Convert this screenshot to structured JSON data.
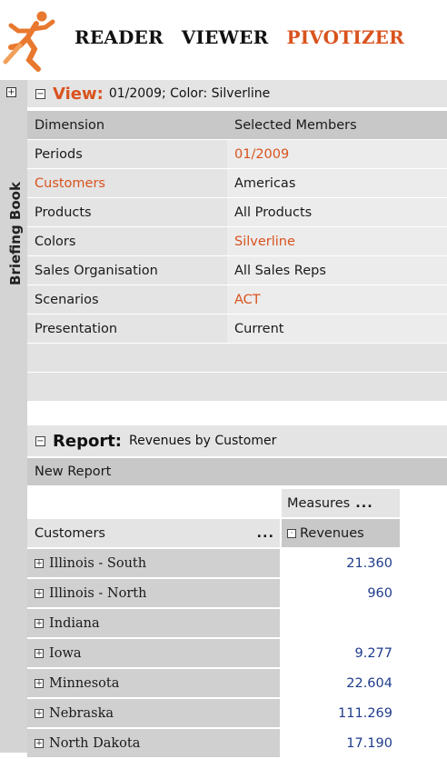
{
  "nav": {
    "reader": "READER",
    "viewer": "VIEWER",
    "pivotizer": "PIVOTIZER"
  },
  "sidebar": {
    "label": "Briefing Book"
  },
  "view": {
    "title": "View:",
    "subtitle": "01/2009; Color: Silverline",
    "headers": {
      "dimension": "Dimension",
      "members": "Selected Members"
    },
    "rows": [
      {
        "dimension": "Periods",
        "member": "01/2009",
        "member_highlight": true,
        "dim_highlight": false
      },
      {
        "dimension": "Customers",
        "member": "Americas",
        "member_highlight": false,
        "dim_highlight": true
      },
      {
        "dimension": "Products",
        "member": "All Products",
        "member_highlight": false,
        "dim_highlight": false
      },
      {
        "dimension": "Colors",
        "member": "Silverline",
        "member_highlight": true,
        "dim_highlight": false
      },
      {
        "dimension": "Sales Organisation",
        "member": "All Sales Reps",
        "member_highlight": false,
        "dim_highlight": false
      },
      {
        "dimension": "Scenarios",
        "member": "ACT",
        "member_highlight": true,
        "dim_highlight": false
      },
      {
        "dimension": "Presentation",
        "member": "Current",
        "member_highlight": false,
        "dim_highlight": false
      }
    ]
  },
  "report": {
    "title": "Report:",
    "subtitle": "Revenues by Customer",
    "new_report": "New Report",
    "measures_label": "Measures",
    "row_dimension": "Customers",
    "measure": "Revenues",
    "more": "...",
    "rows": [
      {
        "customer": "Illinois - South",
        "revenue": "21.360"
      },
      {
        "customer": "Illinois - North",
        "revenue": "960"
      },
      {
        "customer": "Indiana",
        "revenue": ""
      },
      {
        "customer": "Iowa",
        "revenue": "9.277"
      },
      {
        "customer": "Minnesota",
        "revenue": "22.604"
      },
      {
        "customer": "Nebraska",
        "revenue": "111.269"
      },
      {
        "customer": "North Dakota",
        "revenue": "17.190"
      }
    ]
  },
  "colors": {
    "accent": "#d9531e",
    "value": "#1f3c8c",
    "header_gray": "#c8c8c8",
    "cell_gray": "#e4e4e4"
  },
  "icons": {
    "logo": "runner-logo-icon",
    "expand": "plus-box-icon",
    "collapse": "minus-box-icon"
  }
}
